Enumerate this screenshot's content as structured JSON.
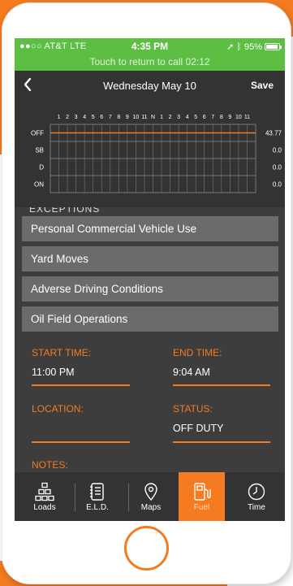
{
  "colors": {
    "accent": "#f47b20",
    "call_green": "#5cbf43",
    "screen_bg": "#3a3a3a",
    "row_bg": "#6b6b6b"
  },
  "status_bar": {
    "carrier": "●●○○ AT&T  LTE",
    "time": "4:35 PM",
    "battery": "95%",
    "battery_level": 0.95,
    "call_banner": "Touch to return to call 02:12"
  },
  "nav": {
    "title": "Wednesday May 10",
    "save_label": "Save",
    "back_icon": "chevron-left-icon"
  },
  "log_graph": {
    "hour_labels": [
      "1",
      "2",
      "3",
      "4",
      "5",
      "6",
      "7",
      "8",
      "9",
      "10",
      "11",
      "N",
      "1",
      "2",
      "3",
      "4",
      "5",
      "6",
      "7",
      "8",
      "9",
      "10",
      "11"
    ],
    "rows": [
      {
        "label": "OFF",
        "total": "43.77"
      },
      {
        "label": "SB",
        "total": "0.0"
      },
      {
        "label": "D",
        "total": "0.0"
      },
      {
        "label": "ON",
        "total": "0.0"
      }
    ]
  },
  "exceptions": {
    "section_title_cut": "EXCEPTIONS",
    "items": [
      "Personal Commercial Vehicle Use",
      "Yard Moves",
      "Adverse Driving Conditions",
      "Oil Field Operations"
    ]
  },
  "fields": {
    "start_time": {
      "label": "START TIME:",
      "value": "11:00 PM"
    },
    "end_time": {
      "label": "END TIME:",
      "value": "9:04 AM"
    },
    "location": {
      "label": "LOCATION:",
      "value": ""
    },
    "status": {
      "label": "STATUS:",
      "value": "OFF DUTY"
    },
    "notes": {
      "label": "NOTES:"
    }
  },
  "tabs": [
    {
      "label": "Loads",
      "icon": "loads-icon",
      "active": false
    },
    {
      "label": "E.L.D.",
      "icon": "eld-logbook-icon",
      "active": false
    },
    {
      "label": "Maps",
      "icon": "map-pin-icon",
      "active": false
    },
    {
      "label": "Fuel",
      "icon": "fuel-pump-icon",
      "active": true
    },
    {
      "label": "Time",
      "icon": "clock-icon",
      "active": false
    }
  ]
}
